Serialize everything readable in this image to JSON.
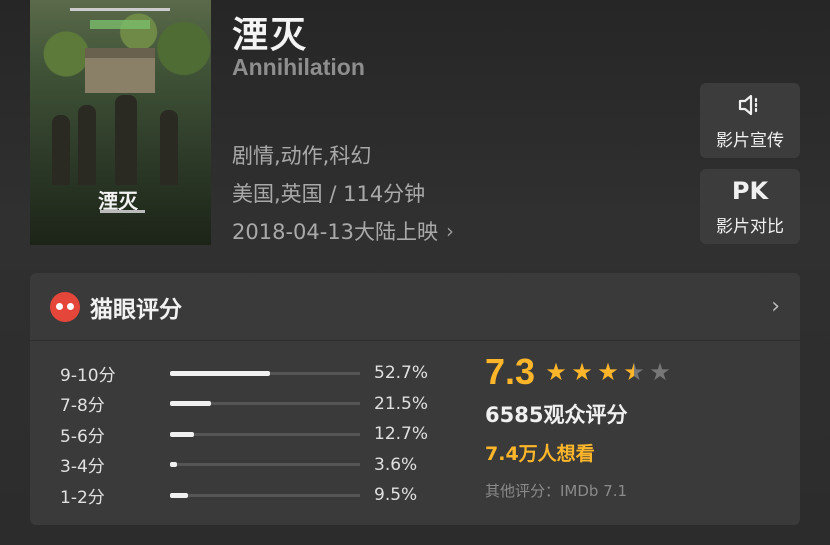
{
  "movie": {
    "title_cn": "湮灭",
    "title_en": "Annihilation",
    "genres": "剧情,动作,科幻",
    "country_duration": "美国,英国 / 114分钟",
    "release": "2018-04-13大陆上映",
    "poster_title": "湮灭"
  },
  "side_buttons": {
    "promo_icon": "speaker-icon",
    "promo_label": "影片宣传",
    "pk_text": "PK",
    "pk_label": "影片对比"
  },
  "rating": {
    "header": "猫眼评分",
    "distribution": [
      {
        "label": "9-10分",
        "pct": "52.7%",
        "value": 52.7
      },
      {
        "label": "7-8分",
        "pct": "21.5%",
        "value": 21.5
      },
      {
        "label": "5-6分",
        "pct": "12.7%",
        "value": 12.7
      },
      {
        "label": "3-4分",
        "pct": "3.6%",
        "value": 3.6
      },
      {
        "label": "1-2分",
        "pct": "9.5%",
        "value": 9.5
      }
    ],
    "score": "7.3",
    "stars": 3.5,
    "votes": "6585观众评分",
    "wants": "7.4万人想看",
    "other": "其他评分：IMDb 7.1"
  },
  "colors": {
    "accent": "#fdb62a",
    "logo": "#e4463a"
  }
}
